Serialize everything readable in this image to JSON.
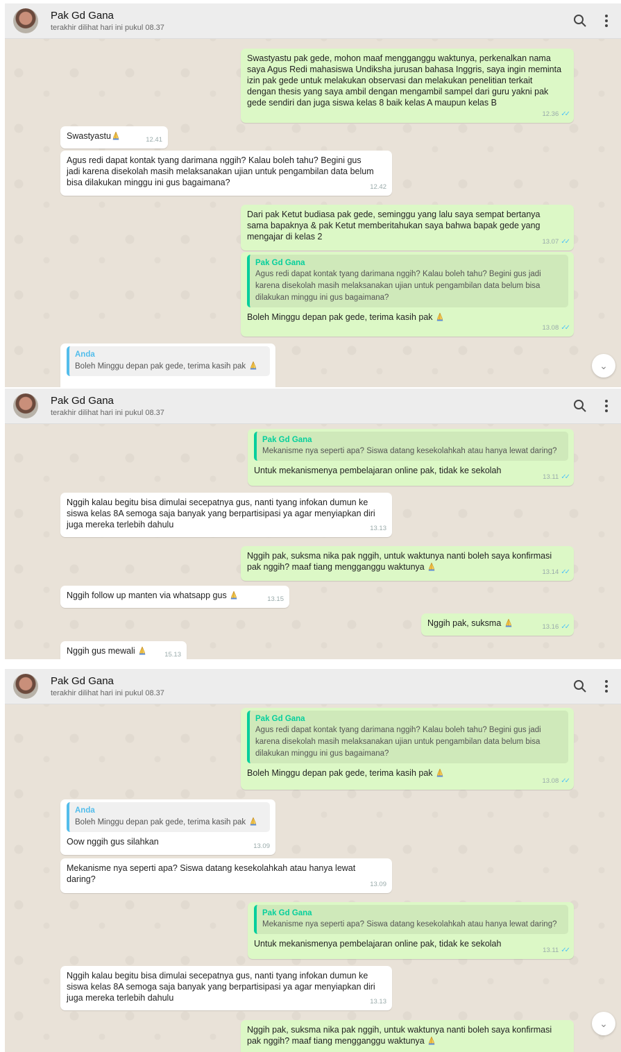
{
  "contact": {
    "name": "Pak Gd Gana",
    "status": "terakhir dilihat hari ini pukul 08.37"
  },
  "icons": {
    "search": "search-icon",
    "menu": "kebab-menu-icon",
    "scroll": "chevron-down-icon",
    "emoji": "folded-hands-emoji"
  },
  "colors": {
    "incoming": "#ffffff",
    "outgoing": "#dcf8c6",
    "read_tick": "#4fc3f7",
    "quote_accent_out": "#06cf9c",
    "quote_accent_in": "#53bdeb"
  },
  "panel1": {
    "m1": {
      "text": "Swastyastu pak gede, mohon maaf mengganggu waktunya, perkenalkan nama\nsaya Agus Redi mahasiswa Undiksha jurusan bahasa Inggris, saya ingin meminta\nizin pak gede untuk melakukan observasi dan melakukan penelitian terkait\ndengan thesis yang saya ambil dengan mengambil sampel dari guru yakni pak\ngede sendiri dan juga siswa kelas 8 baik kelas A maupun kelas B",
      "time": "12.36"
    },
    "m2": {
      "text": "Swastyastu",
      "time": "12.41"
    },
    "m3": {
      "text": "Agus redi dapat kontak tyang darimana nggih? Kalau boleh tahu? Begini gus\njadi karena disekolah masih melaksanakan ujian untuk pengambilan data belum\nbisa dilakukan minggu ini gus bagaimana?",
      "time": "12.42"
    },
    "m4": {
      "text": "Dari pak Ketut budiasa pak gede, seminggu yang lalu saya sempat bertanya\nsama bapaknya & pak Ketut memberitahukan saya bahwa bapak gede yang\nmengajar di kelas 2",
      "time": "13.07"
    },
    "m5": {
      "quote_author": "Pak Gd Gana",
      "quote_text": "Agus redi dapat kontak tyang darimana nggih? Kalau boleh tahu? Begini gus jadi\nkarena disekolah masih melaksanakan ujian untuk pengambilan data belum bisa\ndilakukan minggu ini gus bagaimana?",
      "text": "Boleh Minggu depan pak gede, terima kasih pak",
      "time": "13.08"
    },
    "m6": {
      "quote_author": "Anda",
      "quote_text": "Boleh Minggu depan pak gede, terima kasih pak"
    }
  },
  "panel2": {
    "m1": {
      "quote_author": "Pak Gd Gana",
      "quote_text": "Mekanisme nya seperti apa? Siswa datang kesekolahkah atau hanya lewat daring?",
      "text": "Untuk mekanismenya pembelajaran online pak, tidak ke sekolah",
      "time": "13.11"
    },
    "m2": {
      "text": "Nggih kalau begitu bisa dimulai secepatnya gus, nanti tyang infokan dumun ke\nsiswa kelas 8A semoga saja banyak yang berpartisipasi ya agar menyiapkan diri\njuga mereka terlebih dahulu",
      "time": "13.13"
    },
    "m3": {
      "text": "Nggih pak, suksma nika pak nggih, untuk waktunya nanti boleh saya konfirmasi\npak nggih? maaf tiang mengganggu waktunya",
      "time": "13.14"
    },
    "m4": {
      "text": "Nggih follow up manten via whatsapp gus",
      "time": "13.15"
    },
    "m5": {
      "text": "Nggih pak, suksma",
      "time": "13.16"
    },
    "m6": {
      "text": "Nggih gus mewali",
      "time": "15.13"
    }
  },
  "panel3": {
    "m1": {
      "quote_author": "Pak Gd Gana",
      "quote_text": "Agus redi dapat kontak tyang darimana nggih? Kalau boleh tahu? Begini gus jadi\nkarena disekolah masih melaksanakan ujian untuk pengambilan data belum bisa\ndilakukan minggu ini gus bagaimana?",
      "text": "Boleh Minggu depan pak gede, terima kasih pak",
      "time": "13.08"
    },
    "m2": {
      "quote_author": "Anda",
      "quote_text": "Boleh Minggu depan pak gede, terima kasih pak",
      "text": "Oow nggih gus silahkan",
      "time": "13.09"
    },
    "m3": {
      "text": "Mekanisme nya seperti apa? Siswa datang kesekolahkah atau hanya lewat\ndaring?",
      "time": "13.09"
    },
    "m4": {
      "quote_author": "Pak Gd Gana",
      "quote_text": "Mekanisme nya seperti apa? Siswa datang kesekolahkah atau hanya lewat daring?",
      "text": "Untuk mekanismenya pembelajaran online pak, tidak ke sekolah",
      "time": "13.11"
    },
    "m5": {
      "text": "Nggih kalau begitu bisa dimulai secepatnya gus, nanti tyang infokan dumun ke\nsiswa kelas 8A semoga saja banyak yang berpartisipasi ya agar menyiapkan diri\njuga mereka terlebih dahulu",
      "time": "13.13"
    },
    "m6": {
      "text": "Nggih pak, suksma nika pak nggih, untuk waktunya nanti boleh saya konfirmasi\npak nggih? maaf tiang mengganggu waktunya"
    }
  }
}
